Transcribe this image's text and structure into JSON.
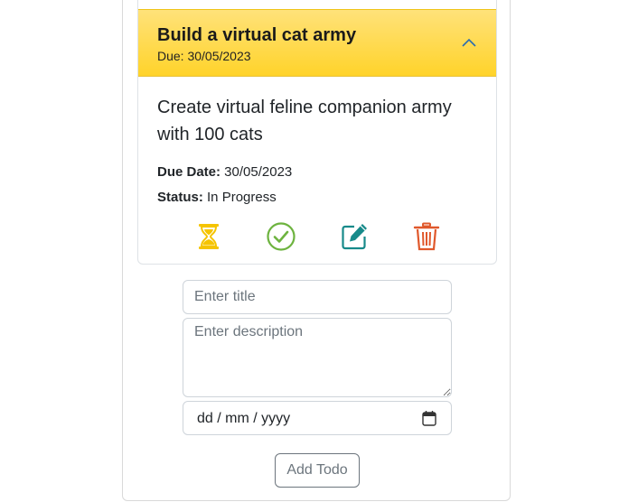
{
  "todo": {
    "title": "Build a virtual cat army",
    "due_header": "Due: 30/05/2023",
    "description": "Create virtual feline companion army with 100 cats",
    "due_date_label": "Due Date:",
    "due_date_value": " 30/05/2023",
    "status_label": "Status:",
    "status_value": " In Progress",
    "header_color": "#ffd32a",
    "actions": [
      {
        "name": "hourglass-icon",
        "color": "#f5c400"
      },
      {
        "name": "check-circle-icon",
        "color": "#6db33f"
      },
      {
        "name": "edit-icon",
        "color": "#178a8a"
      },
      {
        "name": "trash-icon",
        "color": "#e0582b"
      }
    ]
  },
  "form": {
    "title_placeholder": "Enter title",
    "description_placeholder": "Enter description",
    "date_placeholder": "dd / mm / yyyy",
    "submit_label": "Add Todo"
  }
}
